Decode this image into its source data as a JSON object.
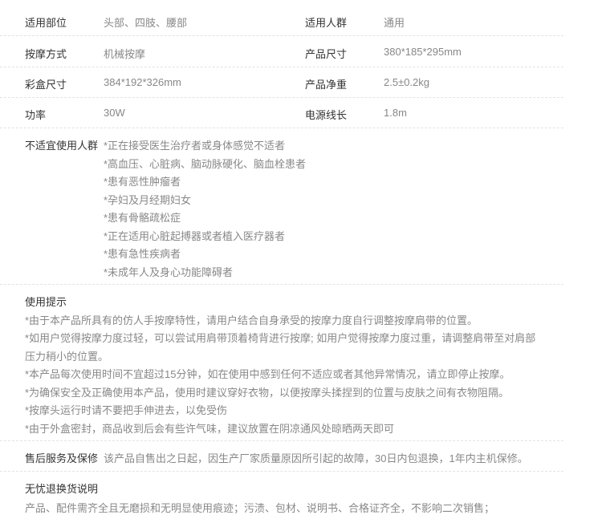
{
  "specs": [
    {
      "label_left": "适用部位",
      "value_left": "头部、四肢、腰部",
      "label_right": "适用人群",
      "value_right": "通用"
    },
    {
      "label_left": "按摩方式",
      "value_left": "机械按摩",
      "label_right": "产品尺寸",
      "value_right": "380*185*295mm"
    },
    {
      "label_left": "彩盒尺寸",
      "value_left": "384*192*326mm",
      "label_right": "产品净重",
      "value_right": "2.5±0.2kg"
    },
    {
      "label_left": "功率",
      "value_left": "30W",
      "label_right": "电源线长",
      "value_right": "1.8m"
    }
  ],
  "unsuitable": {
    "label": "不适宜使用人群",
    "items": [
      "*正在接受医生治疗者或身体感觉不适者",
      "*高血压、心脏病、脑动脉硬化、脑血栓患者",
      "*患有恶性肿瘤者",
      "*孕妇及月经期妇女",
      "*患有骨骼疏松症",
      "*正在适用心脏起搏器或者植入医疗器者",
      "*患有急性疾病者",
      "*未成年人及身心功能障碍者"
    ]
  },
  "tips": {
    "title": "使用提示",
    "lines": [
      "*由于本产品所具有的仿人手按摩特性，请用户结合自身承受的按摩力度自行调整按摩肩带的位置。",
      "*如用户觉得按摩力度过轻，可以尝试用肩带顶着椅背进行按摩; 如用户觉得按摩力度过重，请调整肩带至对肩部",
      "压力稍小的位置。",
      "*本产品每次使用时间不宜超过15分钟，如在使用中感到任何不适应或者其他异常情况，请立即停止按摩。",
      "*为确保安全及正确使用本产品，使用时建议穿好衣物，以便按摩头揉捏到的位置与皮肤之间有衣物阻隔。",
      "*按摩头运行时请不要把手伸进去，以免受伤",
      "*由于外盒密封，商品收到后会有些许气味，建议放置在阴凉通风处晾晒两天即可"
    ]
  },
  "aftersale": {
    "title": "售后服务及保修",
    "text": "该产品自售出之日起，因生产厂家质量原因所引起的故障，30日内包退换，1年内主机保修。"
  },
  "returns": {
    "title": "无忧退换货说明",
    "text": "产品、配件需齐全且无磨损和无明显使用痕迹；污渍、包材、说明书、合格证齐全，不影响二次销售；"
  }
}
